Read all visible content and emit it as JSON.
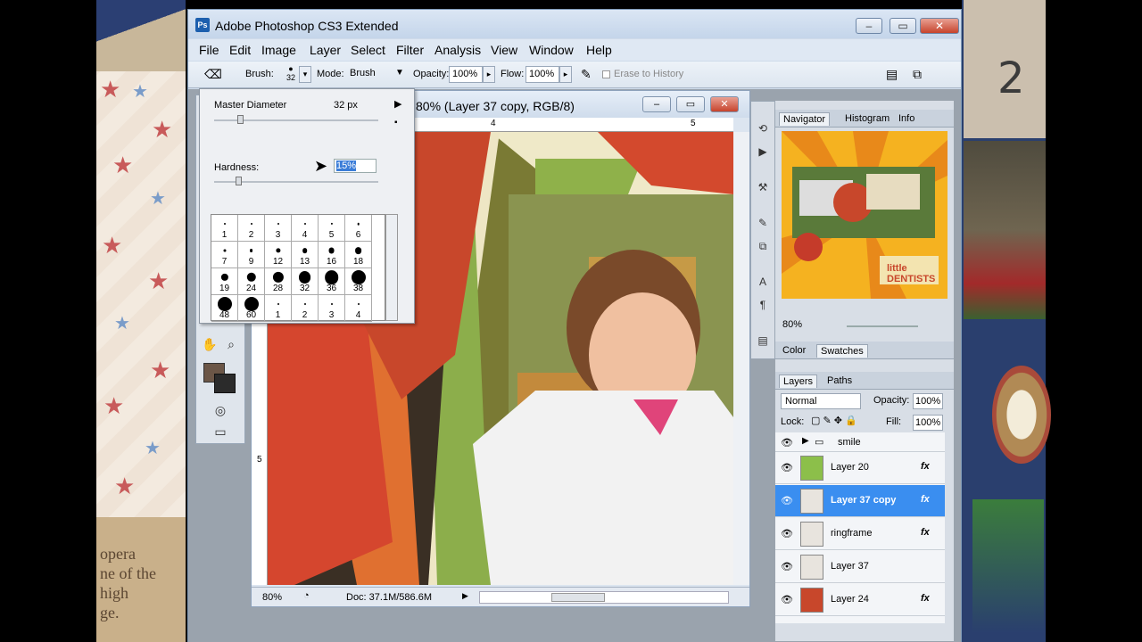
{
  "app": {
    "title": "Adobe Photoshop CS3 Extended",
    "logo_text": "Ps",
    "controls": [
      "–",
      "▭",
      "✕"
    ]
  },
  "menu": [
    "File",
    "Edit",
    "Image",
    "Layer",
    "Select",
    "Filter",
    "Analysis",
    "View",
    "Window",
    "Help"
  ],
  "options": {
    "brush_label": "Brush:",
    "brush_size": "32",
    "mode_label": "Mode:",
    "mode_value": "Brush",
    "opacity_label": "Opacity:",
    "opacity_value": "100%",
    "flow_label": "Flow:",
    "flow_value": "100%",
    "erase_history": "Erase to History"
  },
  "brush_popup": {
    "master_label": "Master Diameter",
    "master_value": "32 px",
    "hardness_label": "Hardness:",
    "hardness_value": "15%",
    "presets": [
      "1",
      "2",
      "3",
      "4",
      "5",
      "6",
      "7",
      "9",
      "12",
      "13",
      "16",
      "18",
      "19",
      "24",
      "28",
      "32",
      "36",
      "38",
      "48",
      "60",
      "1",
      "2",
      "3",
      "4"
    ]
  },
  "document": {
    "title": "80% (Layer 37 copy, RGB/8)",
    "zoom": "80%",
    "doc_info": "Doc: 37.1M/586.6M",
    "ruler_top": [
      "4",
      "5"
    ],
    "ruler_left": [
      "5"
    ]
  },
  "navigator": {
    "tabs": [
      "Navigator",
      "Histogram",
      "Info"
    ],
    "zoom": "80%",
    "thumb_text": "little DENTISTS"
  },
  "color_panel": {
    "tabs": [
      "Color",
      "Swatches"
    ]
  },
  "layers": {
    "tabs": [
      "Layers",
      "Paths"
    ],
    "blend_mode": "Normal",
    "opacity_label": "Opacity:",
    "opacity_value": "100%",
    "lock_label": "Lock:",
    "fill_label": "Fill:",
    "fill_value": "100%",
    "group_name": "smile",
    "rows": [
      {
        "name": "Layer 20",
        "fx": true,
        "active": false,
        "thumb": "#8cbf4a"
      },
      {
        "name": "Layer 37 copy",
        "fx": true,
        "active": true,
        "thumb": "#e8e4de"
      },
      {
        "name": "ringframe",
        "fx": true,
        "active": false,
        "thumb": "#e8e4de"
      },
      {
        "name": "Layer 37",
        "fx": false,
        "active": false,
        "thumb": "#e8e4de"
      },
      {
        "name": "Layer 24",
        "fx": true,
        "active": false,
        "thumb": "#c8472b"
      }
    ]
  },
  "background": {
    "right_number": "2",
    "left_text": [
      "opera",
      "ne of the",
      "high",
      "ge."
    ]
  }
}
